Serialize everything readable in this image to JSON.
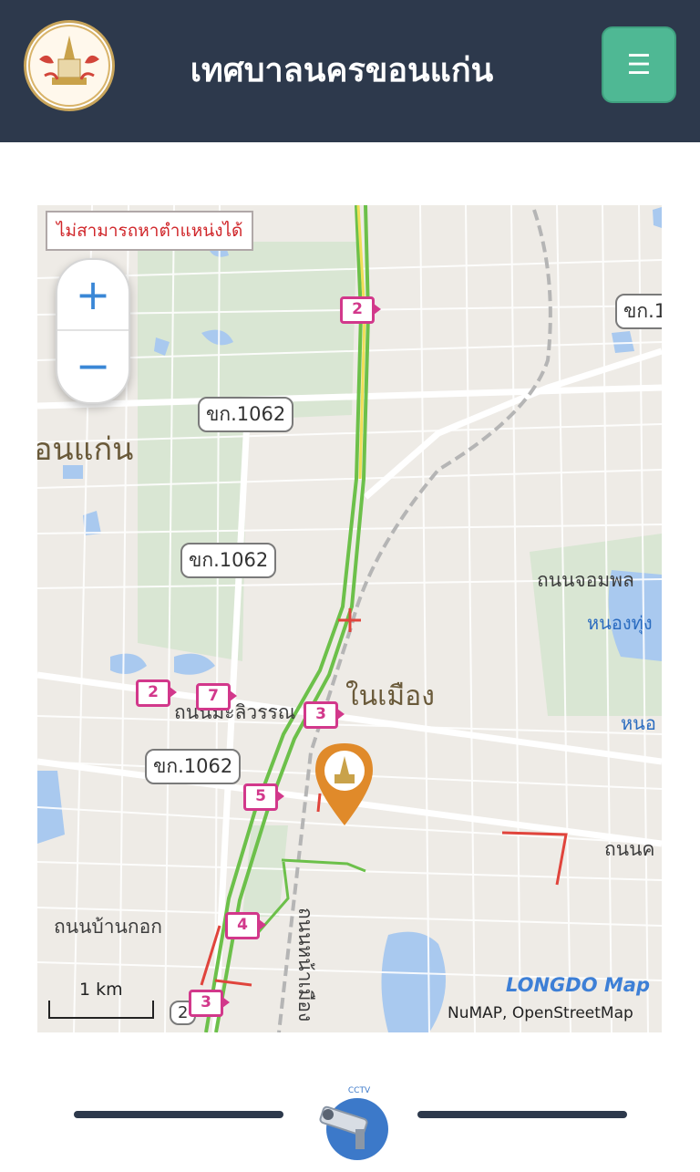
{
  "header": {
    "title": "เทศบาลนครขอนแก่น",
    "logo_text": "เทศบาลนครขอนแก่น",
    "menu_icon": "hamburger-icon"
  },
  "map": {
    "error_message": "ไม่สามารถหาตำแหน่งได้",
    "zoom_in_label": "+",
    "zoom_out_label": "−",
    "road_labels": [
      "ขก.1062",
      "ขก.1062",
      "ขก.1062",
      "ขก.1"
    ],
    "place_labels": [
      "อนแก่น",
      "ในเมือง"
    ],
    "street_labels": [
      "ถนนจอมพล",
      "ถนนบ้านกอก",
      "ถนนค",
      "ถนนหน้าเมือง",
      "ถนนมะลิวรรณ"
    ],
    "water_labels": [
      "หนองทุ่ง",
      "หนอ"
    ],
    "cameras": [
      "2",
      "2",
      "7",
      "3",
      "5",
      "4",
      "3"
    ],
    "route_number": "2",
    "attribution": "NuMAP, OpenStreetMap",
    "brand": "LONGDO Map",
    "scale_label": "1 km"
  },
  "footer": {
    "cctv_icon": "cctv-icon",
    "cctv_label": "CCTV"
  },
  "colors": {
    "header_bg": "#2d394c",
    "menu_button": "#4fb894",
    "traffic_green": "#6cc04a",
    "traffic_red": "#e0443c",
    "camera_pink": "#d2388b"
  }
}
